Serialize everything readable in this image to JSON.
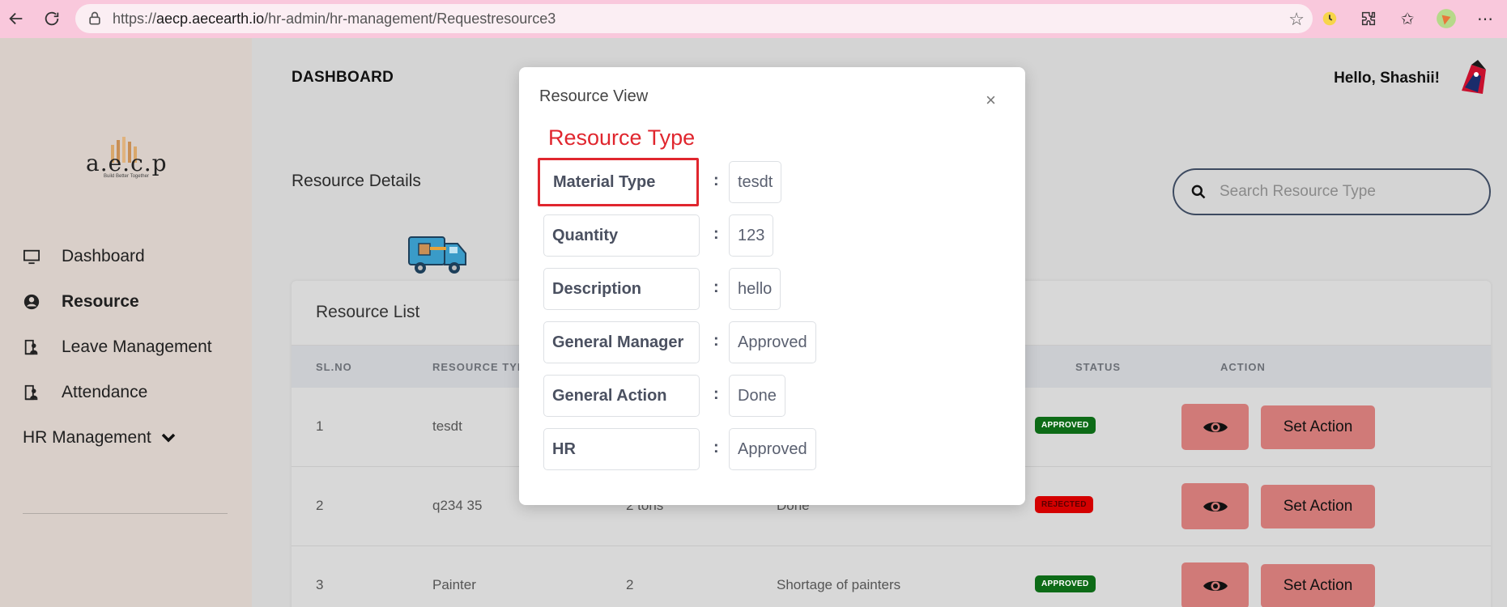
{
  "browser": {
    "url_prefix": "https://",
    "url_host": "aecp.aecearth.io",
    "url_path": "/hr-admin/hr-management/Requestresource3"
  },
  "sidebar": {
    "logo_text": "a.e.c.p",
    "logo_tagline": "Build Better Together",
    "items": [
      {
        "label": "Dashboard",
        "icon": "monitor-icon"
      },
      {
        "label": "Resource",
        "icon": "user-circle-icon"
      },
      {
        "label": "Leave Management",
        "icon": "id-card-icon"
      },
      {
        "label": "Attendance",
        "icon": "id-card-icon"
      },
      {
        "label": "HR Management",
        "icon": "chevron-down-icon"
      }
    ]
  },
  "header": {
    "title": "DASHBOARD",
    "greeting": "Hello, Shashii!"
  },
  "page": {
    "section_title": "Resource Details",
    "search_placeholder": "Search Resource Type"
  },
  "table": {
    "title": "Resource List",
    "headers": [
      "SL.NO",
      "RESOURCE TYPE",
      "STATUS",
      "ACTION"
    ],
    "rows": [
      {
        "sl": "1",
        "type": "tesdt",
        "qty": "",
        "desc": "",
        "status": "APPROVED",
        "status_color": "#0d6b17"
      },
      {
        "sl": "2",
        "type": "q234 35",
        "qty": "2 tons",
        "desc": "Done",
        "status": "REJECTED",
        "status_color": "#d40000"
      },
      {
        "sl": "3",
        "type": "Painter",
        "qty": "2",
        "desc": "Shortage of painters",
        "status": "APPROVED",
        "status_color": "#0d6b17"
      }
    ],
    "action_label": "Set Action"
  },
  "modal": {
    "title": "Resource View",
    "close": "×",
    "heading": "Resource Type",
    "fields": [
      {
        "label": "Material Type",
        "value": "tesdt"
      },
      {
        "label": "Quantity",
        "value": "123"
      },
      {
        "label": "Description",
        "value": "hello"
      },
      {
        "label": "General Manager",
        "value": "Approved"
      },
      {
        "label": "General Action",
        "value": "Done"
      },
      {
        "label": "HR",
        "value": "Approved"
      }
    ]
  }
}
